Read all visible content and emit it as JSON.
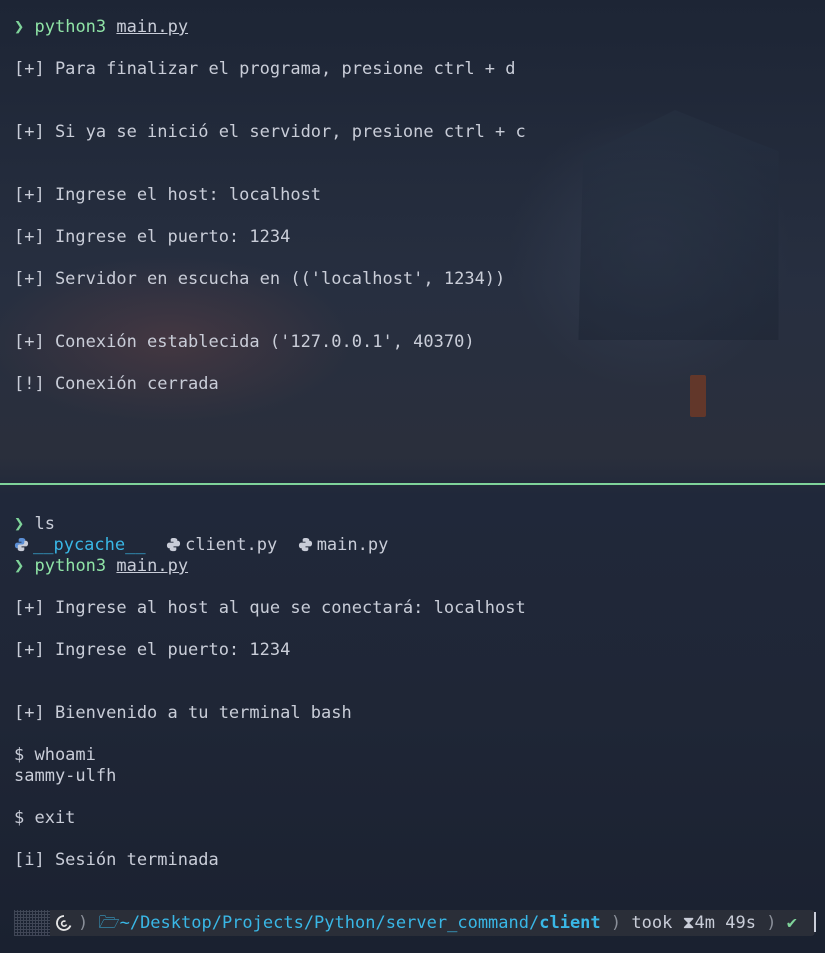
{
  "top": {
    "prompt_symbol": "❯",
    "command": "python3",
    "file": "main.py",
    "lines": [
      "[+] Para finalizar el programa, presione ctrl + d",
      "[+] Si ya se inició el servidor, presione ctrl + c",
      "[+] Ingrese el host: localhost",
      "[+] Ingrese el puerto: 1234",
      "[+] Servidor en escucha en (('localhost', 1234))",
      "[+] Conexión establecida ('127.0.0.1', 40370)",
      "[!] Conexión cerrada"
    ]
  },
  "bottom": {
    "prompt_symbol": "❯",
    "ls_command": "ls",
    "ls_items": [
      "__pycache__",
      "client.py",
      "main.py"
    ],
    "command": "python3",
    "file": "main.py",
    "lines": [
      "[+] Ingrese al host al que se conectará: localhost",
      "[+] Ingrese el puerto: 1234",
      "[+] Bienvenido a tu terminal bash",
      "$ whoami",
      "sammy-ulfh",
      "$ exit",
      "[i] Sesión terminada"
    ]
  },
  "statusbar": {
    "path": "~/Desktop/Projects/Python/server_command/",
    "dir": "client",
    "took_label": "took",
    "duration": "4m 49s",
    "status": "✔"
  },
  "colors": {
    "accent_green": "#7fd39a",
    "path_blue": "#39b7e6"
  }
}
